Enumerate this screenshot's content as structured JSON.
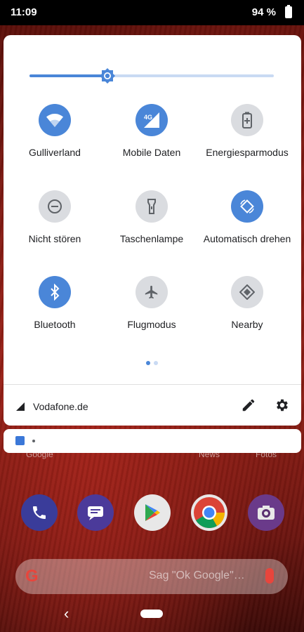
{
  "status_bar": {
    "time": "11:09",
    "battery": "94 %"
  },
  "quick_settings": {
    "brightness_level": 0.32,
    "tiles": [
      {
        "label": "Gulliverland",
        "icon": "wifi-icon",
        "active": true
      },
      {
        "label": "Mobile Daten",
        "icon": "mobile-data-4g-icon",
        "active": true,
        "badge": "4G"
      },
      {
        "label": "Energiesparmodus",
        "icon": "battery-saver-icon",
        "active": false
      },
      {
        "label": "Nicht stören",
        "icon": "do-not-disturb-icon",
        "active": false
      },
      {
        "label": "Taschenlampe",
        "icon": "flashlight-icon",
        "active": false
      },
      {
        "label": "Automatisch drehen",
        "icon": "auto-rotate-icon",
        "active": true
      },
      {
        "label": "Bluetooth",
        "icon": "bluetooth-icon",
        "active": true
      },
      {
        "label": "Flugmodus",
        "icon": "airplane-icon",
        "active": false
      },
      {
        "label": "Nearby",
        "icon": "nearby-icon",
        "active": false
      }
    ],
    "page_index": 1,
    "page_count": 2,
    "carrier": "Vodafone.de"
  },
  "home_screen": {
    "app_labels": [
      "Google",
      "News",
      "Fotos"
    ],
    "search_hint": "Sag \"Ok Google\"…"
  },
  "colors": {
    "accent": "#4a86d8",
    "tile_off": "#dadce0",
    "icon_off": "#5f6368",
    "panel": "#ffffff"
  }
}
